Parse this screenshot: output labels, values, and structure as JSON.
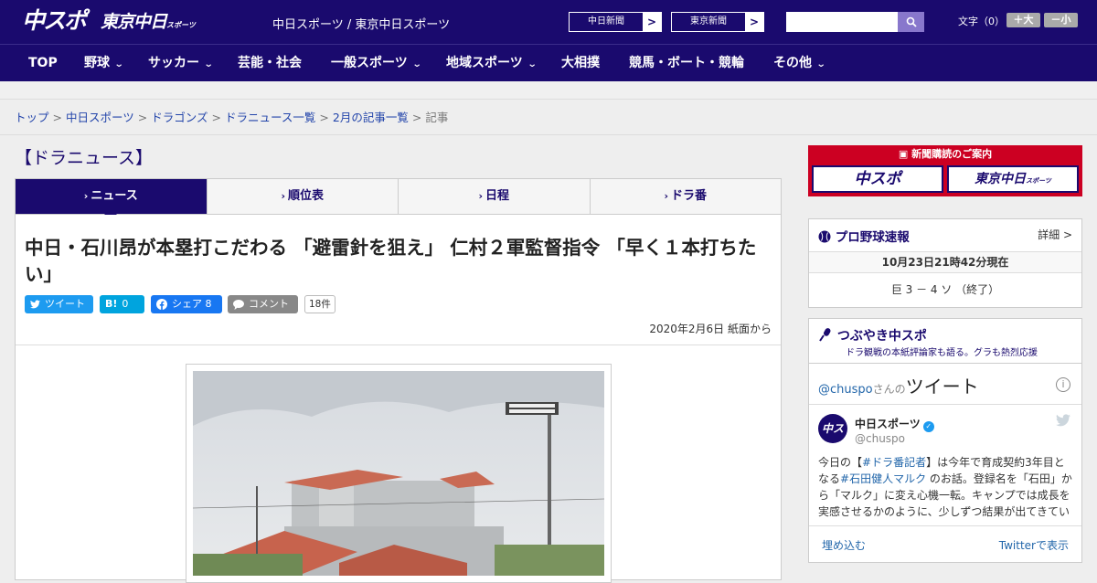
{
  "header": {
    "logo_chuspo": "中スポ",
    "logo_tokyo": "東京中日",
    "logo_tokyo_small": "スポーツ",
    "site_name": "中日スポーツ / 東京中日スポーツ",
    "ext_links": [
      {
        "label": "中日新聞",
        "arrow": ">"
      },
      {
        "label": "東京新聞",
        "arrow": ">"
      }
    ],
    "search_placeholder": "",
    "font_size_label": "文字（0）",
    "font_increase": "＋大",
    "font_decrease": "－小"
  },
  "nav": {
    "items": [
      {
        "label": "TOP",
        "dropdown": false
      },
      {
        "label": "野球",
        "dropdown": true
      },
      {
        "label": "サッカー",
        "dropdown": true
      },
      {
        "label": "芸能・社会",
        "dropdown": false
      },
      {
        "label": "一般スポーツ",
        "dropdown": true
      },
      {
        "label": "地域スポーツ",
        "dropdown": true
      },
      {
        "label": "大相撲",
        "dropdown": false
      },
      {
        "label": "競馬・ボート・競輪",
        "dropdown": false
      },
      {
        "label": "その他",
        "dropdown": true
      }
    ]
  },
  "breadcrumb": {
    "items": [
      "トップ",
      "中日スポーツ",
      "ドラゴンズ",
      "ドラニュース一覧",
      "2月の記事一覧"
    ],
    "current": "記事",
    "separator": ">"
  },
  "section": {
    "title": "【ドラニュース】"
  },
  "tabs": [
    {
      "label": "ニュース",
      "active": true
    },
    {
      "label": "順位表",
      "active": false
    },
    {
      "label": "日程",
      "active": false
    },
    {
      "label": "ドラ番",
      "active": false
    }
  ],
  "article": {
    "headline": "中日・石川昂が本塁打こだわる 「避雷針を狙え」 仁村２軍監督指令 「早く１本打ちたい」",
    "share": {
      "tweet": "ツイート",
      "hatena_icon": "B!",
      "hatena_count": "0",
      "facebook": "シェア",
      "facebook_count": "8",
      "comment": "コメント",
      "comment_count": "18件"
    },
    "date": "2020年2月6日 紙面から"
  },
  "sidebar": {
    "subscription": {
      "title": "新聞購読のご案内",
      "card1": "中スポ",
      "card2": "東京中日",
      "card2_small": "スポーツ"
    },
    "baseball": {
      "title": "プロ野球速報",
      "detail": "詳細 >",
      "time": "10月23日21時42分現在",
      "score": "巨 3 － 4 ソ （終了）"
    },
    "tweets": {
      "title": "つぶやき中スポ",
      "subtitle": "ドラ観戦の本紙評論家も語る。グラも熱烈応援",
      "handle": "@chuspo",
      "handle_suffix": "さんの",
      "handle_label": "ツイート",
      "info": "i",
      "account_name": "中日スポーツ",
      "account_user": "@chuspo",
      "avatar_text": "中スポ",
      "text_pre": "今日の【",
      "text_tag1": "#ドラ番記者",
      "text_mid1": "】は今年で育成契約3年目となる",
      "text_tag2": "#石田健人マルク",
      "text_mid2": " のお話。登録名を「石田」から「マルク」に変え心機一転。キャンプでは成長を実感させるかのように、少しずつ結果が出てきている",
      "embed": "埋め込む",
      "view_on_twitter": "Twitterで表示"
    }
  },
  "colors": {
    "brand_navy": "#1a0a6e",
    "subscription_red": "#cc0022",
    "twitter_blue": "#1d9bf0",
    "hatena_blue": "#00a4de",
    "facebook_blue": "#1877f2"
  }
}
